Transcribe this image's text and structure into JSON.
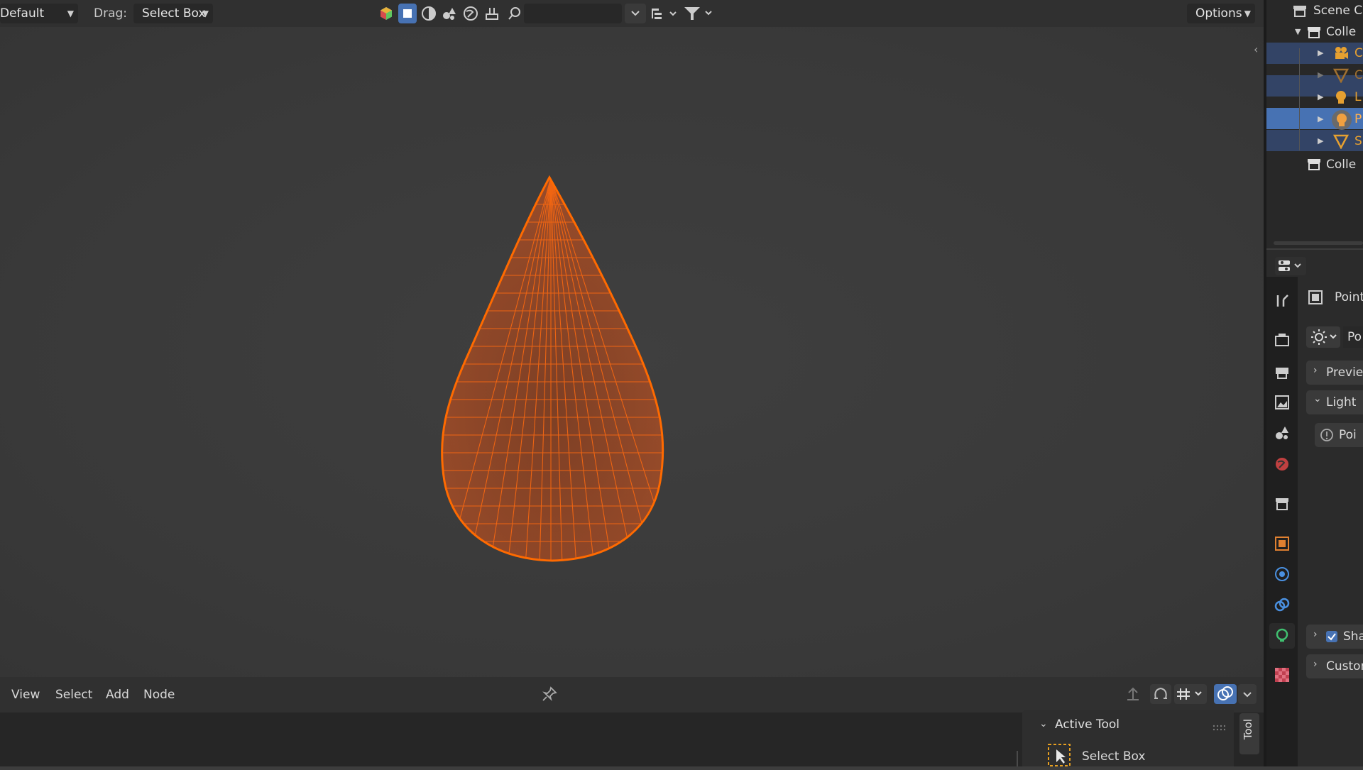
{
  "header": {
    "editor_type_value": "Default",
    "drag_label": "Drag:",
    "drag_value": "Select Box",
    "options_label": "Options"
  },
  "node_menu": {
    "view": "View",
    "select": "Select",
    "add": "Add",
    "node": "Node"
  },
  "active_tool": {
    "title": "Active Tool",
    "tool_name": "Select Box",
    "tab_label": "Tool"
  },
  "outliner": {
    "root": "Scene Co",
    "collection1": "Colle",
    "collection2": "Colle",
    "items": [
      "C",
      "C",
      "L",
      "P",
      "S"
    ]
  },
  "properties": {
    "object_name": "Point",
    "light_type": "Po",
    "preview": "Previe",
    "light": "Light",
    "point": "Poi",
    "shadow": "Sha",
    "custom": "Custor"
  },
  "colors": {
    "accent": "#4772b3",
    "selected_orange": "#ff6a00",
    "wire_orange": "#e05a10",
    "header_bg": "#303030"
  }
}
